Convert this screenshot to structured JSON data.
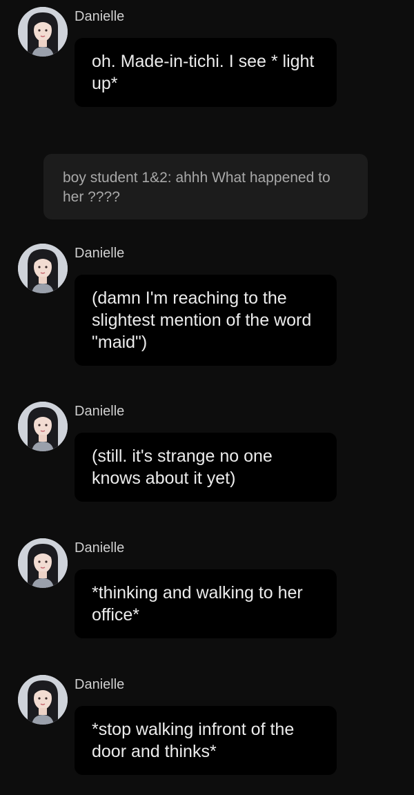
{
  "narration": {
    "text": "boy student 1&2: ahhh What happened to her ????"
  },
  "messages": [
    {
      "sender": "Danielle",
      "text": "oh. Made-in-tichi. I see * light up*",
      "avatar_icon": "girl-portrait-icon"
    },
    {
      "sender": "Danielle",
      "text": "(damn I'm reaching to the slightest mention of the word \"maid\")",
      "avatar_icon": "girl-portrait-icon"
    },
    {
      "sender": "Danielle",
      "text": "(still. it's strange no one knows about it yet)",
      "avatar_icon": "girl-portrait-icon"
    },
    {
      "sender": "Danielle",
      "text": "*thinking and walking to her office*",
      "avatar_icon": "girl-portrait-icon"
    },
    {
      "sender": "Danielle",
      "text": "*stop walking infront of the door and thinks*",
      "avatar_icon": "girl-portrait-icon"
    }
  ],
  "colors": {
    "background": "#0d0d0d",
    "bubble": "#000000",
    "narration_bubble": "#1c1c1c",
    "sender_text": "#cfcfcf",
    "message_text": "#ececec",
    "narration_text": "#a9a9a9"
  }
}
